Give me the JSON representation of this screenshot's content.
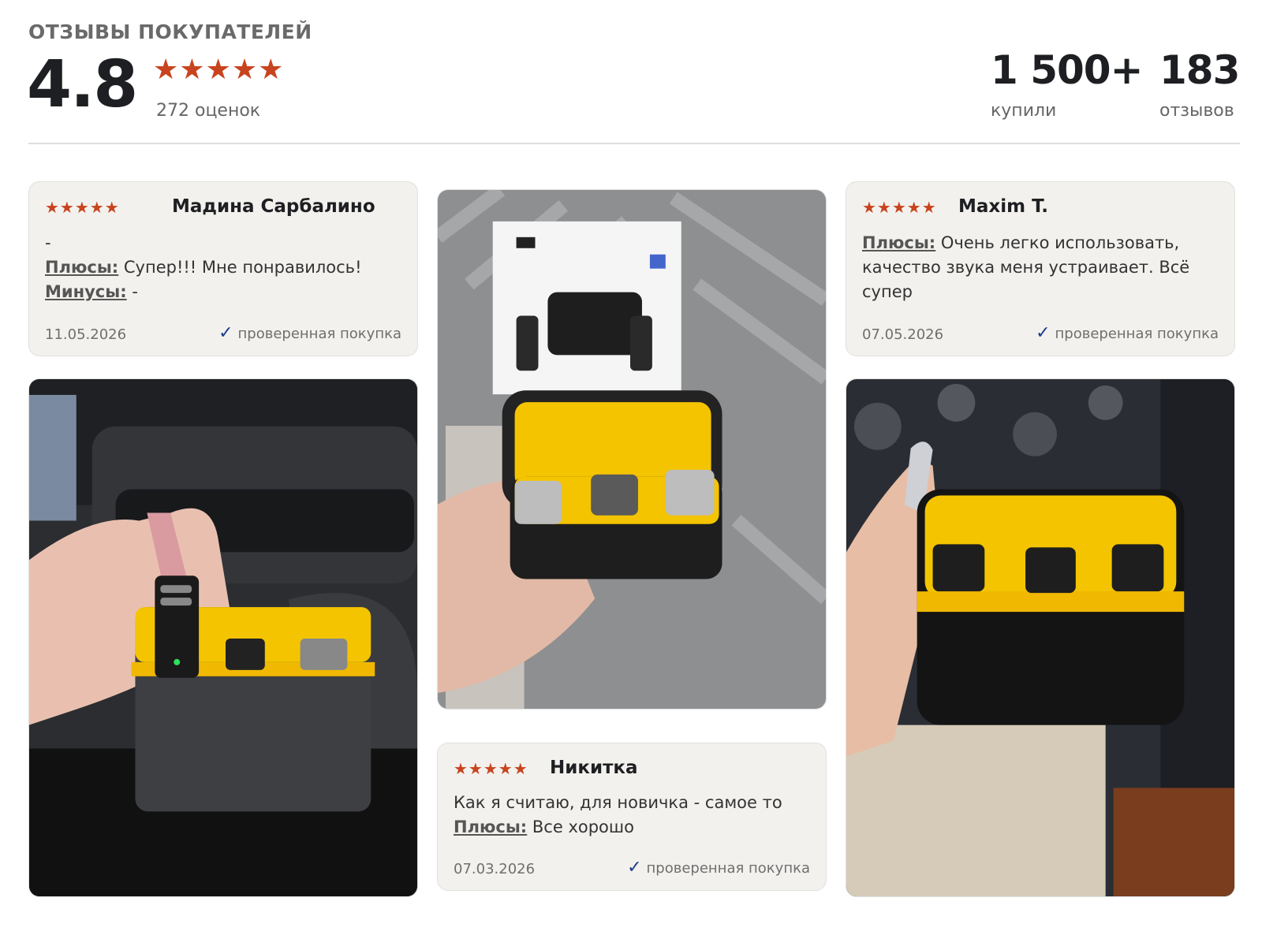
{
  "header": {
    "title": "ОТЗЫВЫ ПОКУПАТЕЛЕЙ",
    "rating": "4.8",
    "stars": "★★★★★",
    "rating_count": "272 оценок",
    "rating_stars_value": 4.8,
    "bought_value": "1 500+",
    "bought_label": "купили",
    "reviews_value": "183",
    "reviews_label": "отзывов"
  },
  "reviews": [
    {
      "stars": "★★★★★",
      "rating": 5,
      "author": "Мадина Сарбалино",
      "text": "-",
      "pros_label": "Плюсы:",
      "pros": " Супер!!! Мне понравилось!",
      "cons_label": "Минусы:",
      "cons": " -",
      "date": "11.05.2026",
      "verified": "проверенная покупка"
    },
    {
      "stars": "★★★★★",
      "rating": 5,
      "author": "Maxim T.",
      "pros_label": "Плюсы:",
      "pros": " Очень легко использовать, качество звука меня устраивает. Всё супер",
      "date": "07.05.2026",
      "verified": "проверенная покупка"
    },
    {
      "stars": "★★★★★",
      "rating": 5,
      "author": "Никитка",
      "text": "Как я считаю, для новичка - самое то",
      "pros_label": "Плюсы:",
      "pros": " Все хорошо",
      "date": "07.03.2026",
      "verified": "проверенная покупка"
    }
  ],
  "icons": {
    "star": "star-icon",
    "verified": "checkmark-icon"
  },
  "colors": {
    "star": "#c8441e",
    "check": "#1c3c8c",
    "card_bg": "#f3f1ee",
    "case_yellow": "#f4c400",
    "case_black": "#1b1b1b"
  }
}
